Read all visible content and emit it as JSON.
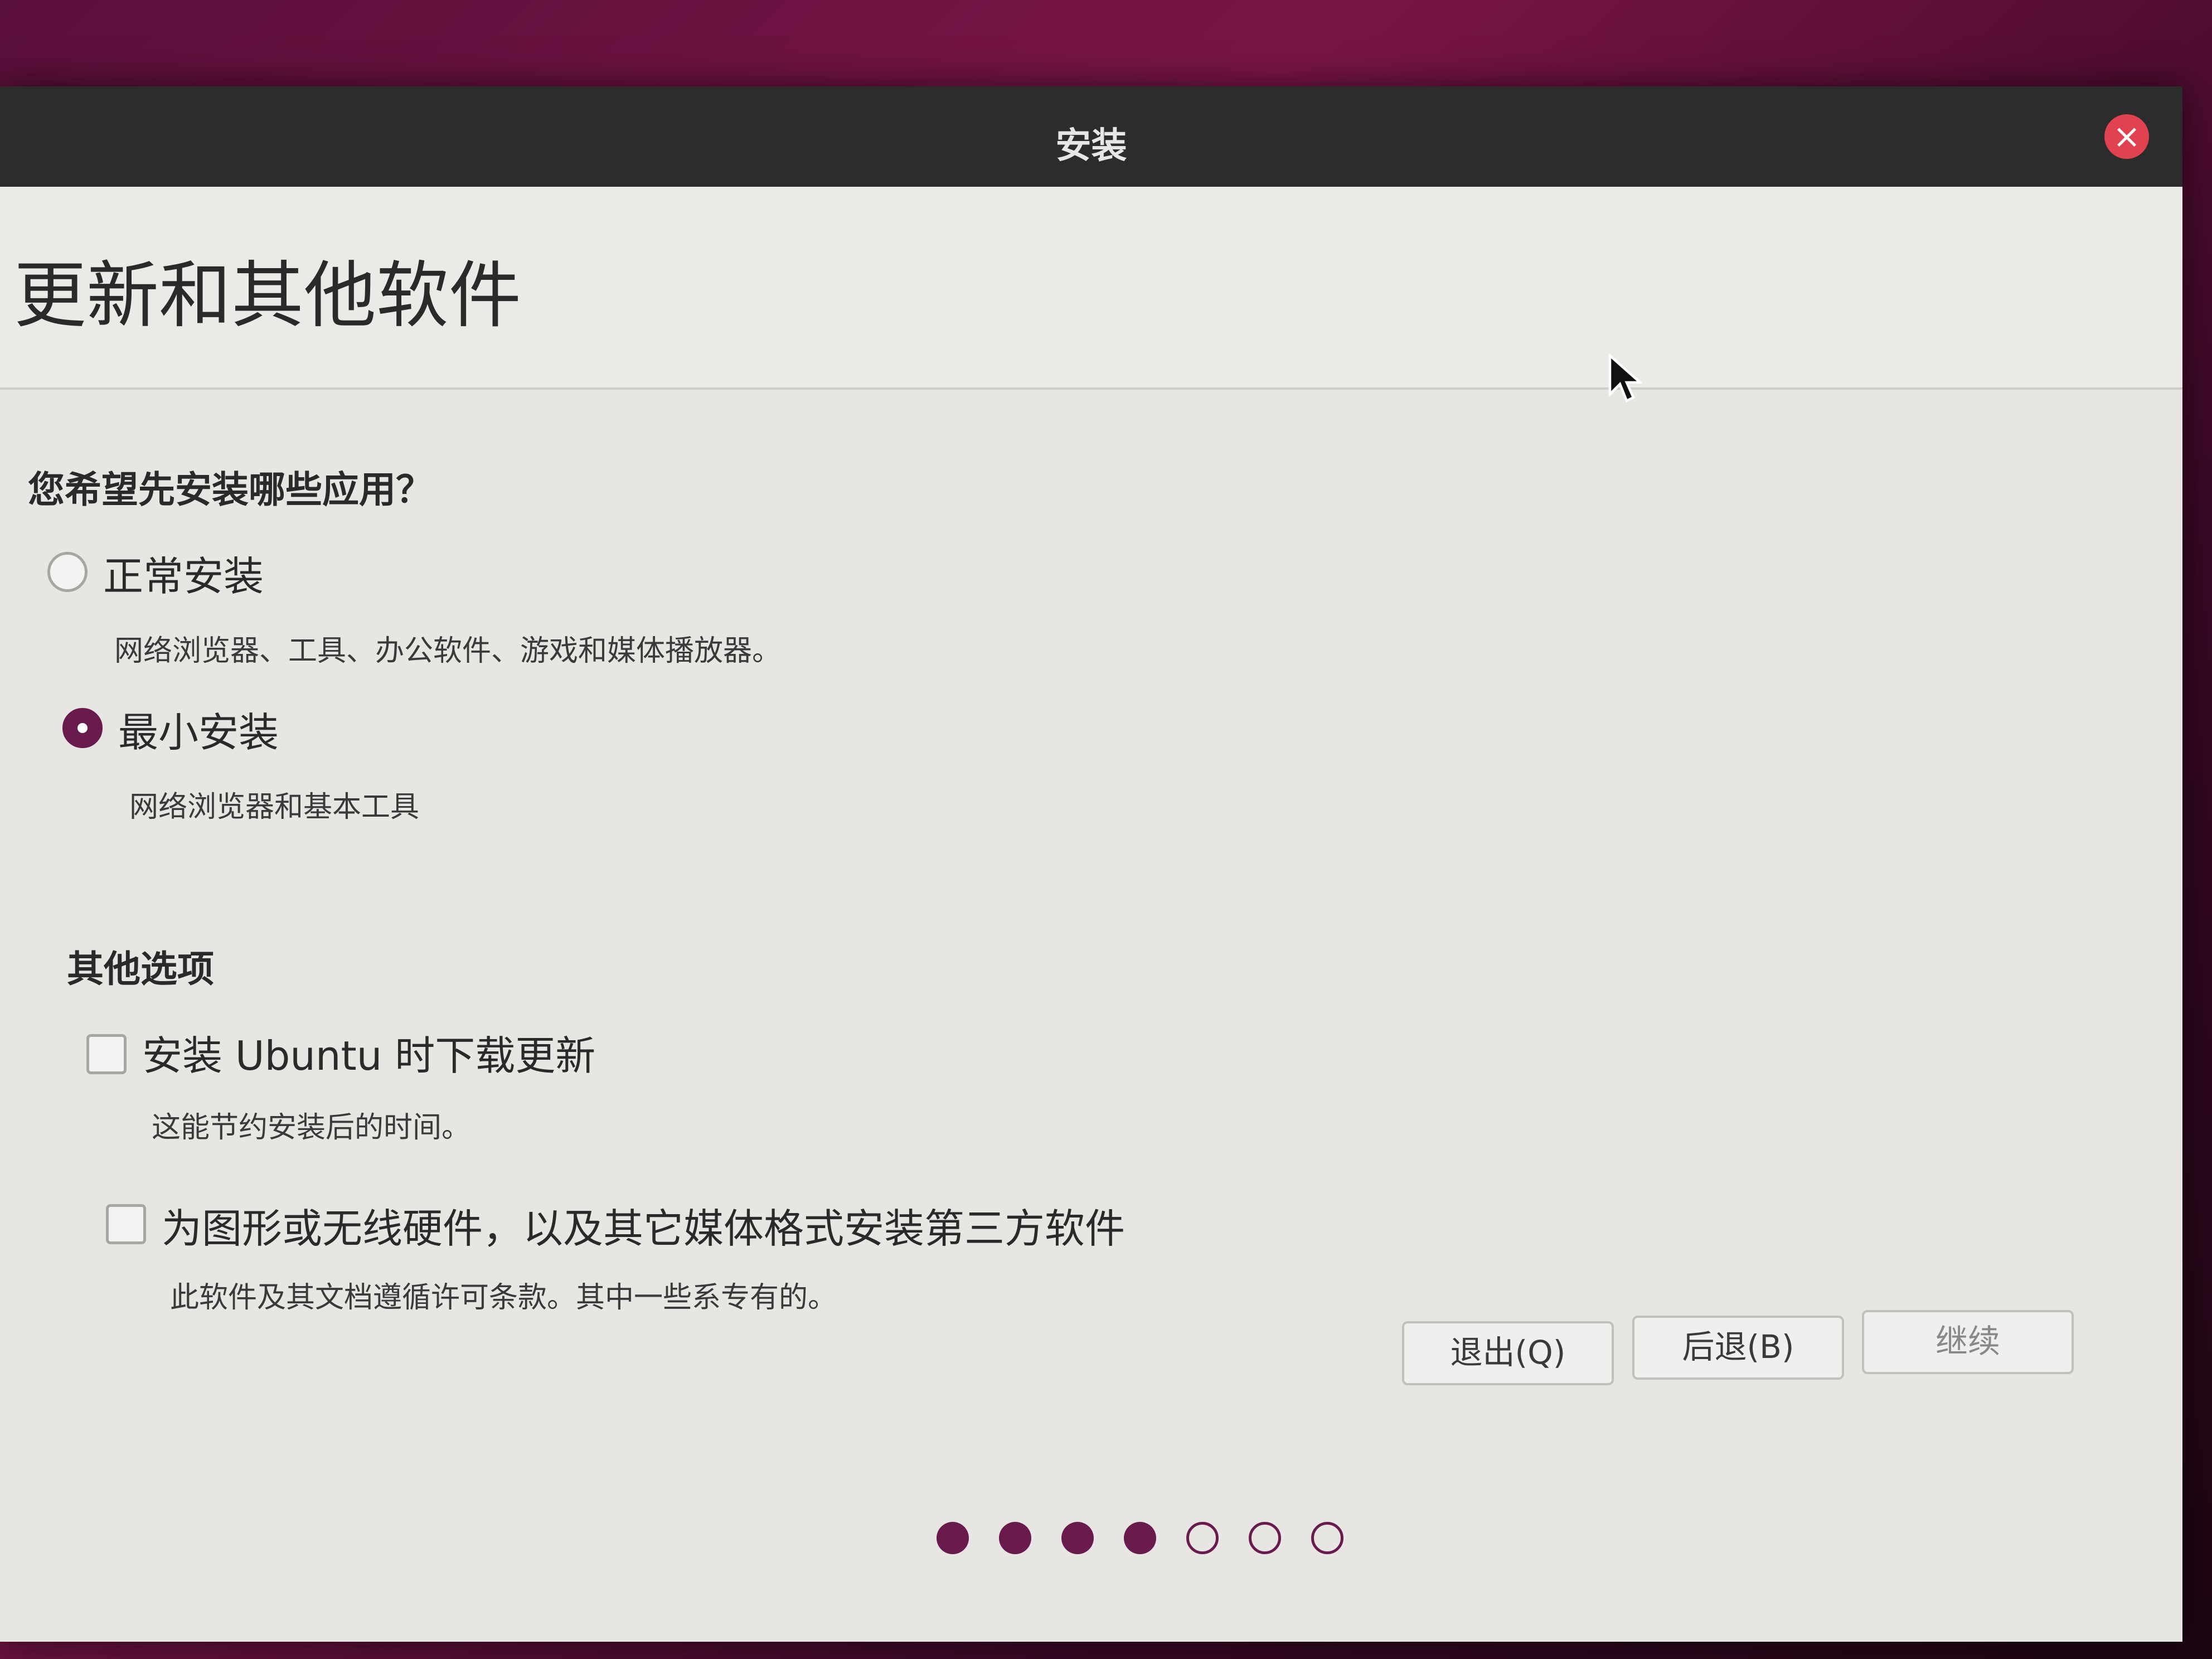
{
  "window": {
    "title": "安装"
  },
  "header": {
    "page_title": "更新和其他软件"
  },
  "install_type": {
    "question": "您希望先安装哪些应用？",
    "options": [
      {
        "label": "正常安装",
        "description": "网络浏览器、工具、办公软件、游戏和媒体播放器。",
        "selected": false
      },
      {
        "label": "最小安装",
        "description": "网络浏览器和基本工具",
        "selected": true
      }
    ]
  },
  "other_options": {
    "title": "其他选项",
    "items": [
      {
        "label": "安装 Ubuntu 时下载更新",
        "description": "这能节约安装后的时间。",
        "checked": false
      },
      {
        "label": "为图形或无线硬件，以及其它媒体格式安装第三方软件",
        "description": "此软件及其文档遵循许可条款。其中一些系专有的。",
        "checked": false
      }
    ]
  },
  "buttons": {
    "quit": "退出(Q)",
    "back": "后退(B)",
    "continue": "继续"
  },
  "progress": {
    "total_steps": 7,
    "completed_steps": 4
  },
  "colors": {
    "accent": "#6a1b4d",
    "close": "#e0424f"
  }
}
